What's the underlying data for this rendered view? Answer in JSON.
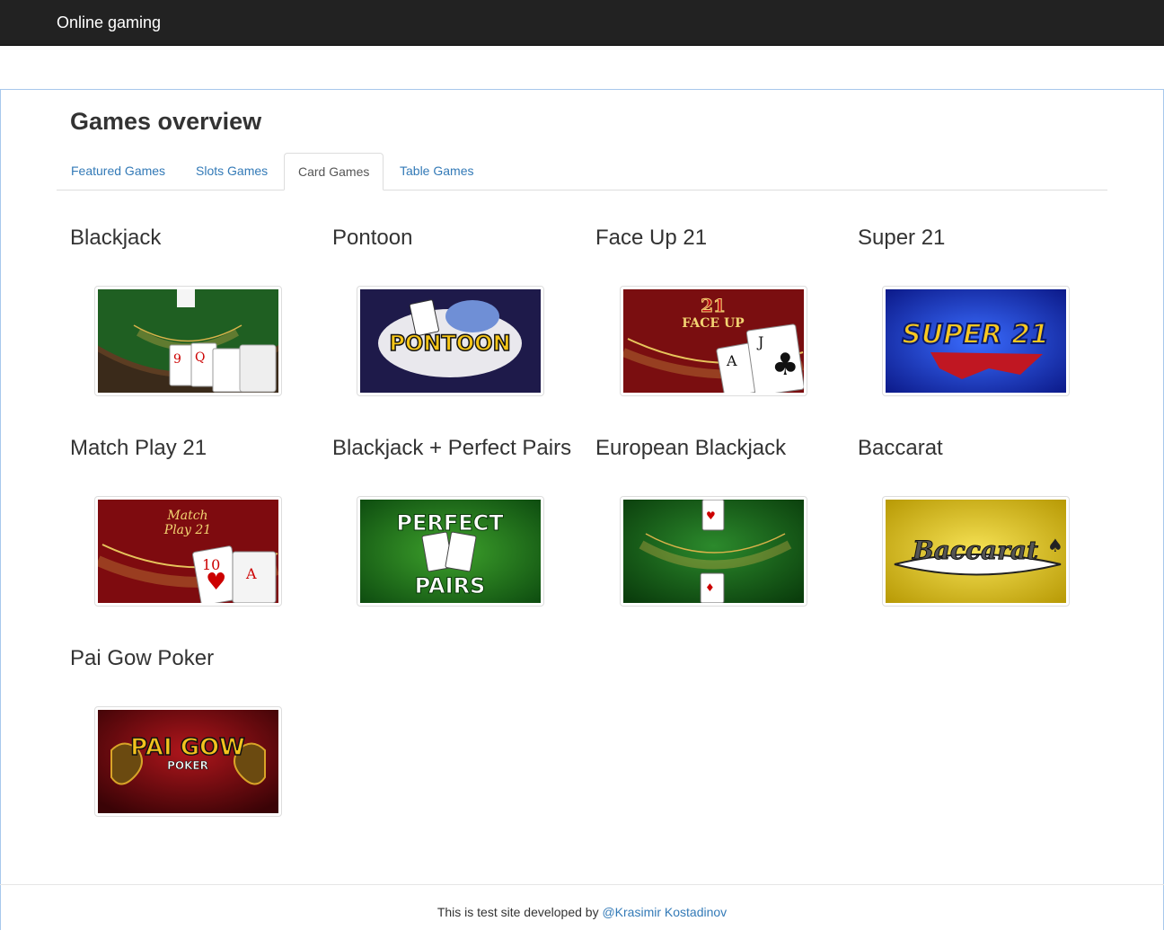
{
  "navbar": {
    "brand": "Online gaming"
  },
  "page": {
    "title": "Games overview"
  },
  "tabs": [
    {
      "label": "Featured Games",
      "active": false
    },
    {
      "label": "Slots Games",
      "active": false
    },
    {
      "label": "Card Games",
      "active": true
    },
    {
      "label": "Table Games",
      "active": false
    }
  ],
  "games": [
    {
      "title": "Blackjack",
      "thumb": "blackjack-table-thumbnail"
    },
    {
      "title": "Pontoon",
      "thumb": "pontoon-logo-thumbnail",
      "logo_text": "PONTOON"
    },
    {
      "title": "Face Up 21",
      "thumb": "face-up-21-thumbnail"
    },
    {
      "title": "Super 21",
      "thumb": "super-21-thumbnail",
      "logo_text": "SUPER 21"
    },
    {
      "title": "Match Play 21",
      "thumb": "match-play-21-thumbnail"
    },
    {
      "title": "Blackjack + Perfect Pairs",
      "thumb": "perfect-pairs-thumbnail",
      "logo_text_top": "PERFECT",
      "logo_text_bottom": "PAIRS"
    },
    {
      "title": "European Blackjack",
      "thumb": "european-blackjack-thumbnail"
    },
    {
      "title": "Baccarat",
      "thumb": "baccarat-thumbnail",
      "logo_text": "Baccarat"
    },
    {
      "title": "Pai Gow Poker",
      "thumb": "pai-gow-poker-thumbnail",
      "logo_text": "PAI GOW",
      "logo_sub": "POKER"
    }
  ],
  "footer": {
    "text": "This is test site developed by ",
    "link": "@Krasimir Kostadinov"
  },
  "colors": {
    "navbar": "#222222",
    "link": "#337ab7",
    "panel_border": "#a8c8ec"
  }
}
